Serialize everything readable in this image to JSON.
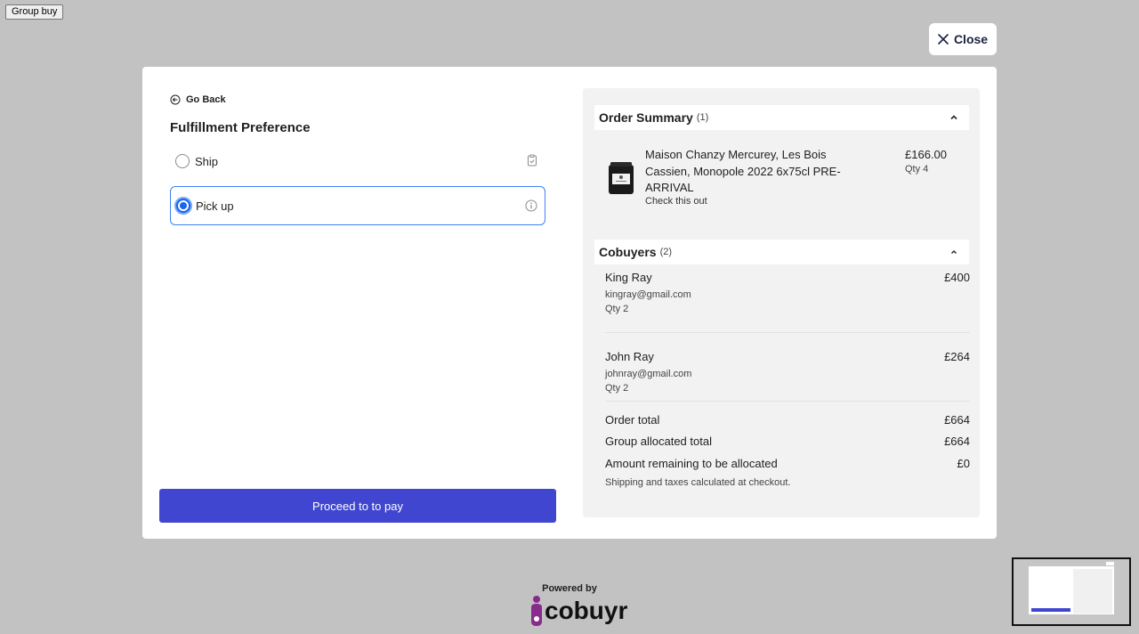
{
  "top": {
    "group_buy_label": "Group buy",
    "close_label": "Close"
  },
  "fulfillment": {
    "go_back_label": "Go Back",
    "title": "Fulfillment Preference",
    "options": [
      {
        "label": "Ship",
        "selected": false,
        "icon": "clipboard-check-icon"
      },
      {
        "label": "Pick up",
        "selected": true,
        "icon": "info-icon"
      }
    ],
    "proceed_label": "Proceed to to pay"
  },
  "order_summary": {
    "title": "Order Summary",
    "count": "(1)",
    "product": {
      "name": "Maison Chanzy Mercurey, Les Bois Cassien, Monopole 2022 6x75cl PRE-ARRIVAL",
      "link_label": "Check this out",
      "price": "£166.00",
      "qty": "Qty 4"
    }
  },
  "cobuyers": {
    "title": "Cobuyers",
    "count": "(2)",
    "items": [
      {
        "name": "King Ray",
        "email": "kingray@gmail.com",
        "qty": "Qty 2",
        "amount": "£400"
      },
      {
        "name": "John Ray",
        "email": "johnray@gmail.com",
        "qty": "Qty 2",
        "amount": "£264"
      }
    ]
  },
  "totals": {
    "order_total_label": "Order total",
    "order_total": "£664",
    "group_allocated_label": "Group allocated total",
    "group_allocated": "£664",
    "remaining_label": "Amount remaining to be allocated",
    "remaining": "£0",
    "note": "Shipping and taxes calculated at checkout."
  },
  "footer": {
    "powered_by": "Powered by",
    "brand": "cobuyr"
  },
  "colors": {
    "primary": "#4046cf",
    "selected_border": "#3b82f6",
    "backdrop": "#c2c2c2"
  }
}
